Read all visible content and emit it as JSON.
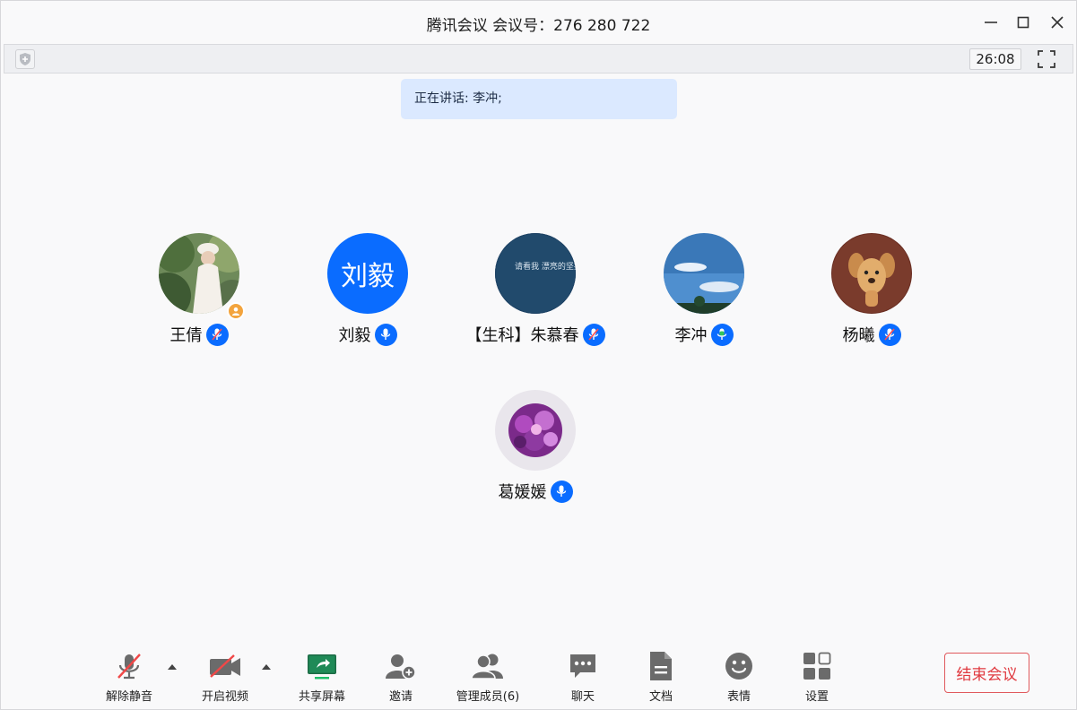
{
  "window": {
    "title": "腾讯会议 会议号：276 280 722"
  },
  "infobar": {
    "timer": "26:08"
  },
  "speaking": {
    "text": "正在讲话: 李冲;"
  },
  "participants": [
    {
      "name": "王倩",
      "avatar": "photo-woman",
      "host": true,
      "mic": "muted"
    },
    {
      "name": "刘毅",
      "avatar_text": "刘毅",
      "mic": "on"
    },
    {
      "name": "【生科】朱慕春",
      "avatar": "text-image",
      "avatar_caption": "请看我 漂亮的坚持",
      "mic": "muted"
    },
    {
      "name": "李冲",
      "avatar": "sky",
      "mic": "speaking"
    },
    {
      "name": "杨曦",
      "avatar": "toy-dog",
      "mic": "muted"
    },
    {
      "name": "葛媛媛",
      "avatar": "flowers",
      "mic": "on"
    }
  ],
  "toolbar": {
    "unmute": "解除静音",
    "start_video": "开启视频",
    "share_screen": "共享屏幕",
    "invite": "邀请",
    "manage_members": "管理成员(6)",
    "chat": "聊天",
    "docs": "文档",
    "reactions": "表情",
    "settings": "设置",
    "end_meeting": "结束会议"
  },
  "colors": {
    "accent": "#0a6cff",
    "share_green": "#1fbf6b",
    "end_red": "#e0393f",
    "speaking_bg": "#dbe9ff",
    "host_badge": "#f3a43d"
  }
}
